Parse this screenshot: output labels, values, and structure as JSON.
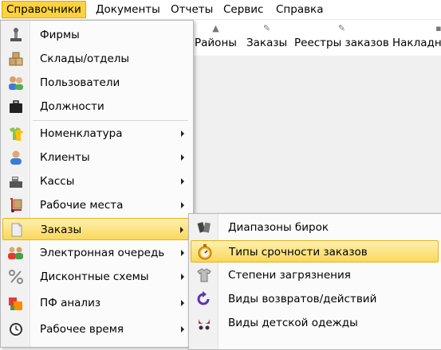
{
  "menubar": {
    "items": [
      {
        "label": "Справочники"
      },
      {
        "label": "Документы"
      },
      {
        "label": "Отчеты"
      },
      {
        "label": "Сервис"
      },
      {
        "label": "Справка"
      }
    ]
  },
  "toolbar": {
    "items": [
      {
        "label": "Районы"
      },
      {
        "label": "Заказы"
      },
      {
        "label": "Реестры заказов"
      },
      {
        "label": "Накладн"
      }
    ]
  },
  "main_menu": {
    "items": [
      {
        "label": "Фирмы",
        "icon": "stamp-icon"
      },
      {
        "label": "Склады/отделы",
        "icon": "boxes-icon"
      },
      {
        "label": "Пользователи",
        "icon": "users-icon"
      },
      {
        "label": "Должности",
        "icon": "briefcase-icon"
      },
      {
        "label": "Номенклатура",
        "icon": "shirts-icon"
      },
      {
        "label": "Клиенты",
        "icon": "user-icon"
      },
      {
        "label": "Кассы",
        "icon": "cash-register-icon"
      },
      {
        "label": "Рабочие места",
        "icon": "hand-truck-icon"
      },
      {
        "label": "Заказы",
        "icon": "document-icon"
      },
      {
        "label": "Электронная очередь",
        "icon": "queue-people-icon"
      },
      {
        "label": "Дисконтные схемы",
        "icon": "percent-icon"
      },
      {
        "label": "ПФ анализ",
        "icon": "chart-icon"
      },
      {
        "label": "Рабочее время",
        "icon": "clock-icon"
      }
    ]
  },
  "sub_menu": {
    "items": [
      {
        "label": "Диапазоны бирок",
        "icon": "tags-icon"
      },
      {
        "label": "Типы срочности заказов",
        "icon": "stopwatch-icon"
      },
      {
        "label": "Степени загрязнения",
        "icon": "tshirt-icon"
      },
      {
        "label": "Виды возвратов/действий",
        "icon": "return-arrow-icon"
      },
      {
        "label": "Виды детской одежды",
        "icon": "stroller-icon"
      }
    ]
  },
  "colors": {
    "highlight": "#fbd85a",
    "menubar_active": "#fbd23f"
  }
}
